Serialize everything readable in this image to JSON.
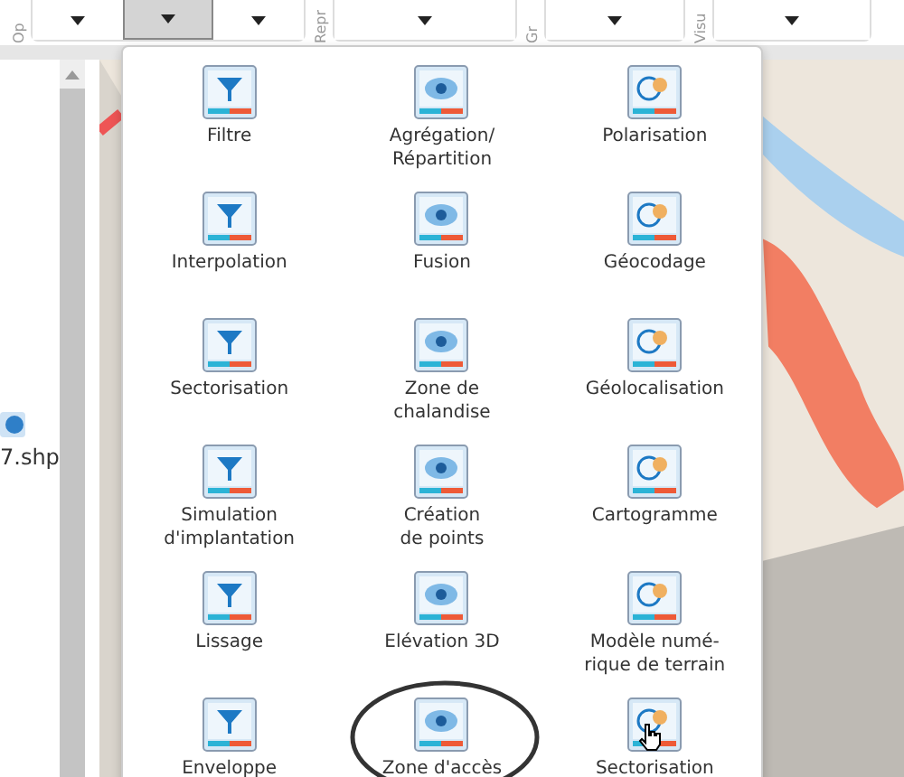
{
  "toolbar": {
    "groups": [
      {
        "label": "Op",
        "buttons": [
          {
            "selected": false
          },
          {
            "selected": true
          },
          {
            "selected": false
          }
        ]
      },
      {
        "label": "Repr",
        "buttons": [
          {
            "selected": false
          }
        ]
      },
      {
        "label": "Gr",
        "buttons": [
          {
            "selected": false
          }
        ]
      },
      {
        "label": "Visu",
        "buttons": [
          {
            "selected": false
          }
        ]
      }
    ]
  },
  "layers_panel": {
    "items": [
      {
        "label": "7.shp"
      }
    ]
  },
  "operations_menu": {
    "items": [
      {
        "label": "Filtre"
      },
      {
        "label": "Agrégation/\nRépartition"
      },
      {
        "label": "Polarisation"
      },
      {
        "label": "Interpolation"
      },
      {
        "label": "Fusion"
      },
      {
        "label": "Géocodage"
      },
      {
        "label": "Sectorisation"
      },
      {
        "label": "Zone de\nchalandise"
      },
      {
        "label": "Géolocalisation"
      },
      {
        "label": "Simulation\nd'implantation"
      },
      {
        "label": "Création\nde points"
      },
      {
        "label": "Cartogramme"
      },
      {
        "label": "Lissage"
      },
      {
        "label": "Elévation 3D"
      },
      {
        "label": "Modèle numé-\nrique de terrain"
      },
      {
        "label": "Enveloppe"
      },
      {
        "label": "Zone d'accès",
        "circled": true
      },
      {
        "label": "Sectorisation",
        "hovered": true
      }
    ]
  }
}
